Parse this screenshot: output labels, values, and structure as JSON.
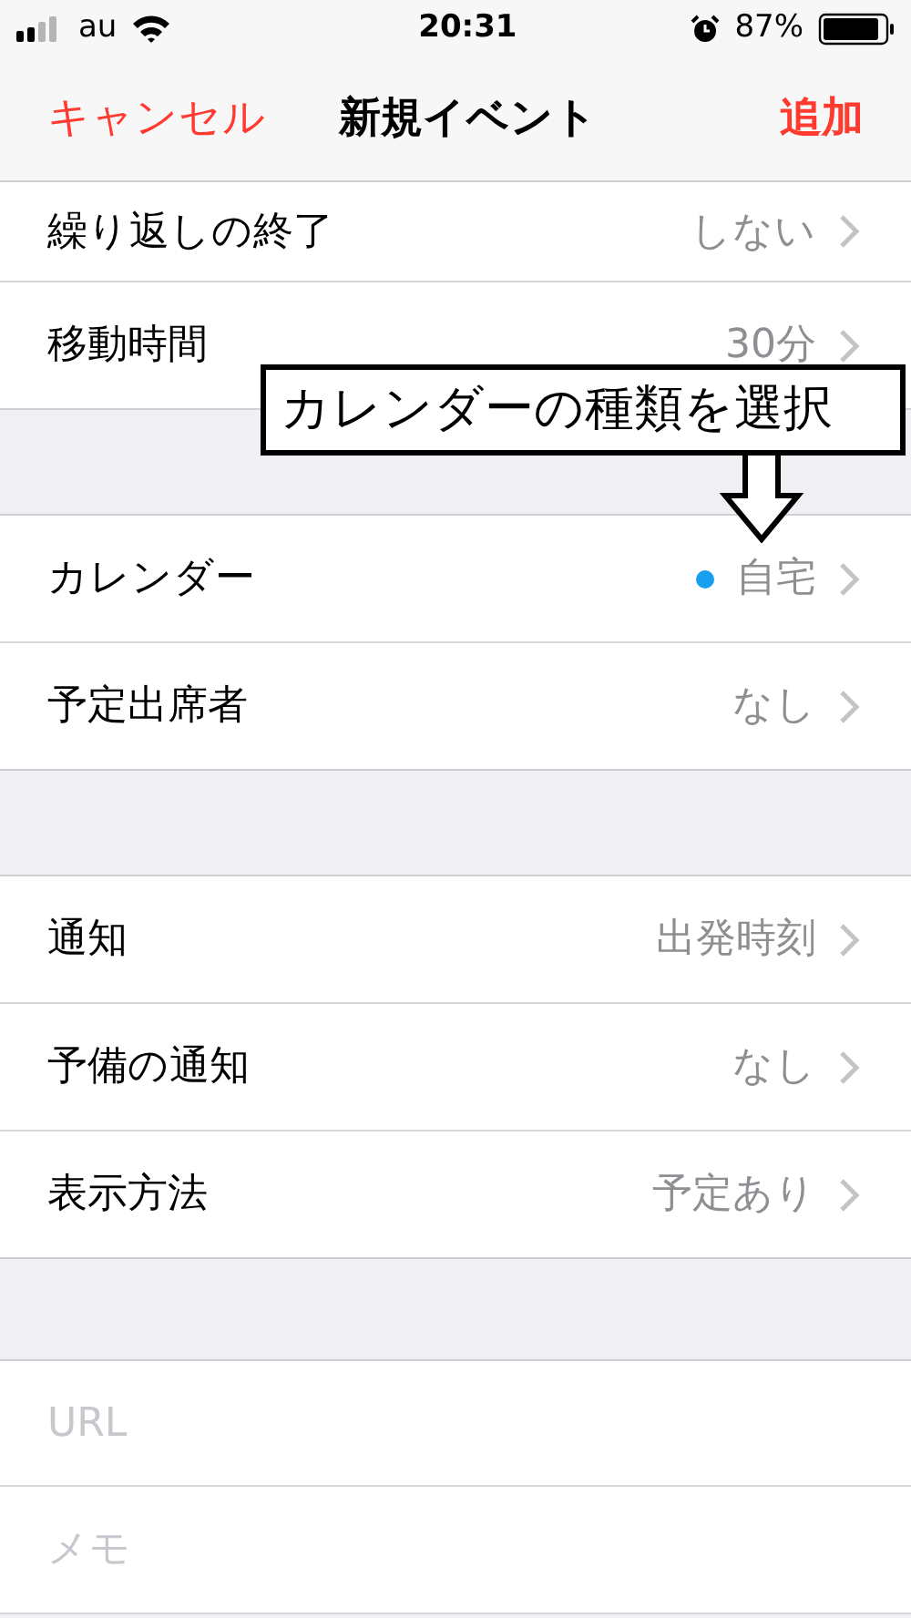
{
  "status_bar": {
    "carrier": "au",
    "time": "20:31",
    "battery": "87%"
  },
  "nav": {
    "cancel": "キャンセル",
    "title": "新規イベント",
    "add": "追加"
  },
  "sections": [
    {
      "rows": [
        {
          "label": "繰り返しの終了",
          "value": "しない"
        },
        {
          "label": "移動時間",
          "value": "30分"
        }
      ]
    },
    {
      "rows": [
        {
          "label": "カレンダー",
          "value": "自宅",
          "color": "#1a9ef0"
        },
        {
          "label": "予定出席者",
          "value": "なし"
        }
      ]
    },
    {
      "rows": [
        {
          "label": "通知",
          "value": "出発時刻"
        },
        {
          "label": "予備の通知",
          "value": "なし"
        },
        {
          "label": "表示方法",
          "value": "予定あり"
        }
      ]
    }
  ],
  "fields": [
    {
      "placeholder": "URL"
    },
    {
      "placeholder": "メモ"
    }
  ],
  "callout": {
    "text": "カレンダーの種類を選択"
  }
}
